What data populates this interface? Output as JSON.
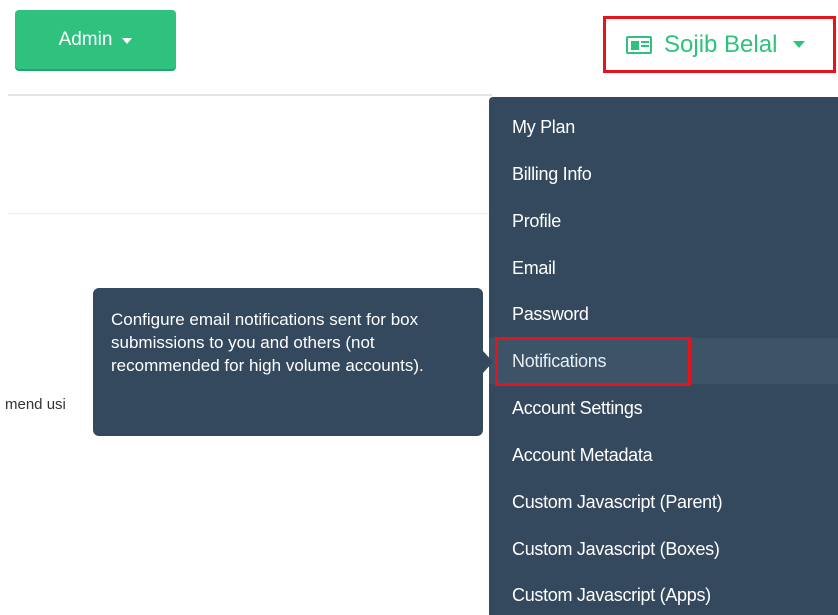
{
  "header": {
    "admin_label": "Admin",
    "user_name": "Sojib Belal"
  },
  "background": {
    "truncated_text": "mend usi"
  },
  "user_menu": {
    "active_item": "Notifications",
    "items": [
      {
        "label": "My Plan"
      },
      {
        "label": "Billing Info"
      },
      {
        "label": "Profile"
      },
      {
        "label": "Email"
      },
      {
        "label": "Password"
      },
      {
        "label": "Notifications"
      },
      {
        "label": "Account Settings"
      },
      {
        "label": "Account Metadata"
      },
      {
        "label": "Custom Javascript (Parent)"
      },
      {
        "label": "Custom Javascript (Boxes)"
      },
      {
        "label": "Custom Javascript (Apps)"
      }
    ]
  },
  "tooltip": {
    "text": "Configure email notifications sent for box submissions to you and others (not recommended for high volume accounts)."
  },
  "colors": {
    "accent_green": "#2ec27e",
    "menu_bg": "#34495e",
    "highlight_red": "#e3141c"
  },
  "icons": {
    "user_icon": "id-card-icon",
    "admin_caret": "caret-down-icon",
    "user_caret": "caret-down-icon"
  }
}
